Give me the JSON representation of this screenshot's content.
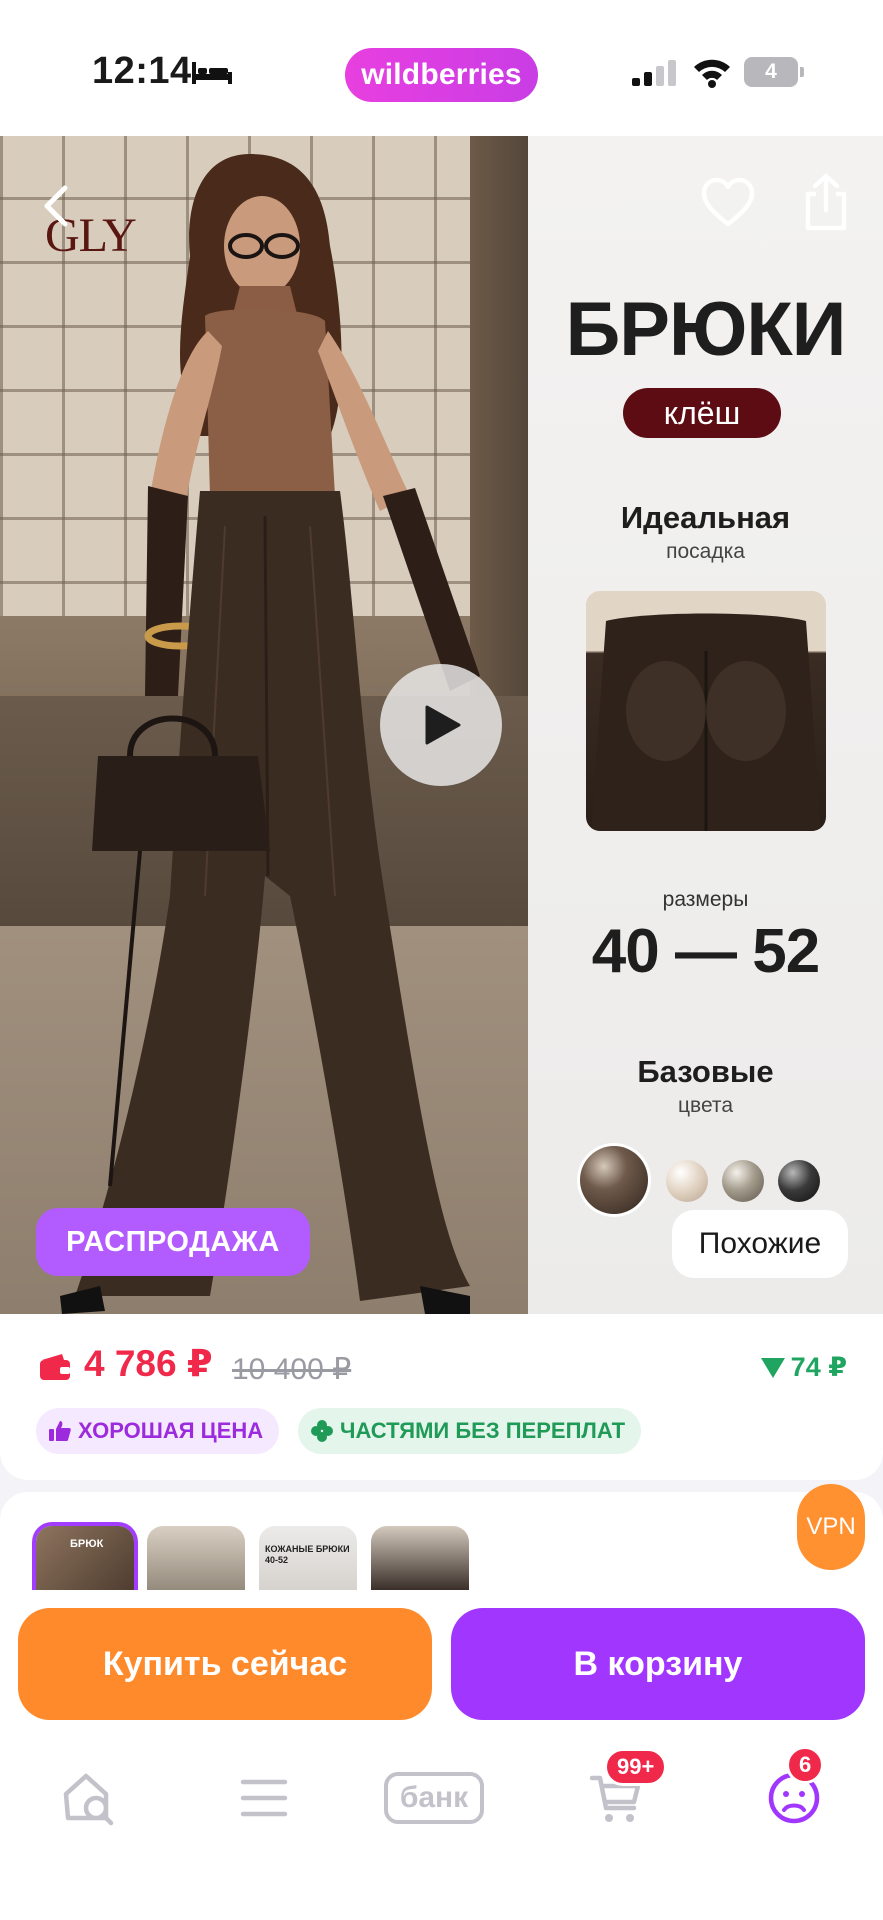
{
  "status_bar": {
    "time": "12:14",
    "brand": "wildberries",
    "battery": "4",
    "icons": [
      "sleep-icon",
      "signal-icon",
      "wifi-icon",
      "battery-icon"
    ]
  },
  "product_media": {
    "logo_text": "GLY",
    "promo": {
      "title": "БРЮКИ",
      "tag": "клёш",
      "fit_title": "Идеальная",
      "fit_sub": "посадка",
      "sizes_label": "размеры",
      "sizes": "40 — 52",
      "colors_title": "Базовые",
      "colors_sub": "цвета"
    },
    "sale_badge": "РАСПРОДАЖА",
    "similar_button": "Похожие",
    "icons": [
      "back-icon",
      "heart-icon",
      "share-icon",
      "play-icon"
    ]
  },
  "price": {
    "current": "4 786 ₽",
    "old": "10 400 ₽",
    "cashback": "74 ₽",
    "tag_good": "ХОРОШАЯ ЦЕНА",
    "tag_installments": "ЧАСТЯМИ БЕЗ ПЕРЕПЛАТ"
  },
  "thumbnails": {
    "thumb1_text": "БРЮК",
    "thumb3_text": "КОЖАНЫЕ БРЮКИ 40-52"
  },
  "vpn_badge": "VPN",
  "actions": {
    "buy_now": "Купить сейчас",
    "add_to_cart": "В корзину"
  },
  "tab_bar": {
    "bank_label": "банк",
    "cart_count": "99+",
    "profile_count": "6",
    "icons": [
      "home-search-icon",
      "menu-icon",
      "bank-icon",
      "cart-icon",
      "profile-icon"
    ]
  },
  "colors": {
    "brand_pink": "#e83fe0",
    "price_red": "#f0294b",
    "purple": "#a136ff",
    "orange": "#ff8a2b",
    "green": "#1fa55f"
  }
}
